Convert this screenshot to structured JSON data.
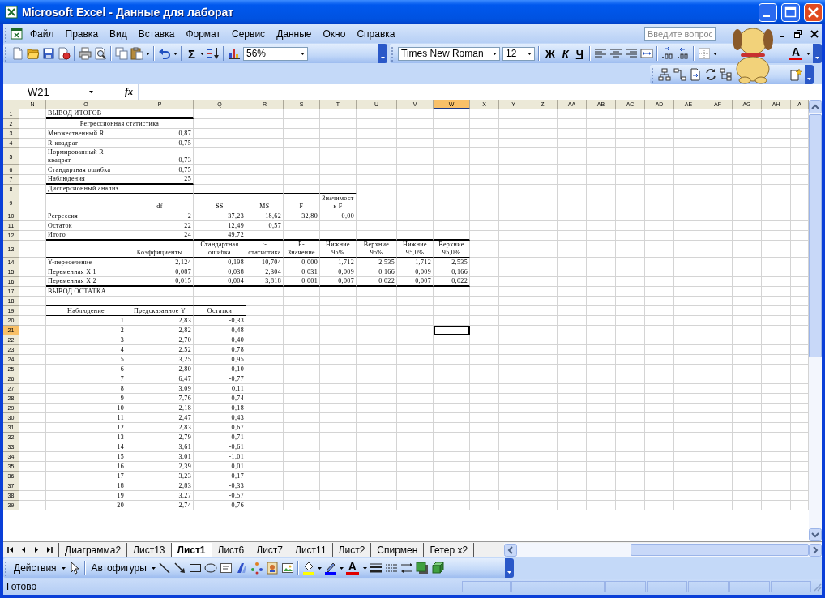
{
  "window": {
    "title": "Microsoft Excel - Данные для лаборат"
  },
  "menu": [
    "Файл",
    "Правка",
    "Вид",
    "Вставка",
    "Формат",
    "Сервис",
    "Данные",
    "Окно",
    "Справка"
  ],
  "help_search": {
    "placeholder": "Введите вопрос"
  },
  "standard_toolbar": {
    "autosum": "Σ",
    "zoom": "56%"
  },
  "formatting_toolbar": {
    "font": "Times New Roman",
    "size": "12",
    "bold": "Ж",
    "italic": "К",
    "underline": "Ч",
    "font_color": "A"
  },
  "formula_bar": {
    "name_box": "W21",
    "fx": "fx"
  },
  "columns": [
    {
      "label": "N",
      "selected": false
    },
    {
      "label": "O",
      "selected": false
    },
    {
      "label": "P",
      "selected": false
    },
    {
      "label": "Q",
      "selected": false
    },
    {
      "label": "R",
      "selected": false
    },
    {
      "label": "S",
      "selected": false
    },
    {
      "label": "T",
      "selected": false
    },
    {
      "label": "U",
      "selected": false
    },
    {
      "label": "V",
      "selected": false
    },
    {
      "label": "W",
      "selected": true
    },
    {
      "label": "X",
      "selected": false
    },
    {
      "label": "Y",
      "selected": false
    },
    {
      "label": "Z",
      "selected": false
    },
    {
      "label": "AA",
      "selected": false
    },
    {
      "label": "AB",
      "selected": false
    },
    {
      "label": "AC",
      "selected": false
    },
    {
      "label": "AD",
      "selected": false
    },
    {
      "label": "AE",
      "selected": false
    },
    {
      "label": "AF",
      "selected": false
    },
    {
      "label": "AG",
      "selected": false
    },
    {
      "label": "AH",
      "selected": false
    },
    {
      "label": "A",
      "selected": false
    }
  ],
  "rows": [
    {
      "label": "1",
      "selected": false,
      "cells": [
        {},
        {
          "text": "ВЫВОД ИТОГОВ",
          "kind": "label",
          "thick_rule": true
        },
        {
          "thick_rule": true
        }
      ]
    },
    {
      "label": "2",
      "selected": false,
      "cells": [
        {},
        {
          "text": "Регрессионная статистика",
          "kind": "title"
        }
      ]
    },
    {
      "label": "3",
      "selected": false,
      "cells": [
        {},
        {
          "text": "Множественный R",
          "kind": "label"
        },
        {
          "text": "0,87",
          "kind": "number"
        }
      ]
    },
    {
      "label": "4",
      "selected": false,
      "cells": [
        {},
        {
          "text": "R-квадрат",
          "kind": "label"
        },
        {
          "text": "0,75",
          "kind": "number"
        }
      ]
    },
    {
      "label": "5",
      "selected": false,
      "cells": [
        {},
        {
          "text": "Нормированный R-квадрат",
          "kind": "label",
          "wrap": true
        },
        {
          "text": "0,73",
          "kind": "number"
        }
      ]
    },
    {
      "label": "6",
      "selected": false,
      "cells": [
        {},
        {
          "text": "Стандартная ошибка",
          "kind": "label"
        },
        {
          "text": "0,75",
          "kind": "number"
        }
      ]
    },
    {
      "label": "7",
      "selected": false,
      "cells": [
        {},
        {
          "text": "Наблюдения",
          "kind": "label",
          "thick_rule": true
        },
        {
          "text": "25",
          "kind": "number",
          "thick_rule": true
        }
      ]
    },
    {
      "label": "8",
      "selected": false,
      "cells": [
        {},
        {
          "text": "Дисперсионный анализ",
          "kind": "label",
          "thick_rule": true
        },
        {
          "thick_rule": true
        },
        {
          "thick_rule": true
        },
        {
          "thick_rule": true
        },
        {
          "thick_rule": true
        },
        {
          "thick_rule": true
        }
      ]
    },
    {
      "label": "9",
      "selected": false,
      "cells": [
        {},
        {
          "thin_rule": true
        },
        {
          "text": "df",
          "kind": "header",
          "thin_rule": true
        },
        {
          "text": "SS",
          "kind": "header",
          "thin_rule": true
        },
        {
          "text": "MS",
          "kind": "header",
          "thin_rule": true
        },
        {
          "text": "F",
          "kind": "header",
          "thin_rule": true
        },
        {
          "text": "Значимость F",
          "kind": "header",
          "wrap": true,
          "thin_rule": true
        }
      ]
    },
    {
      "label": "10",
      "selected": false,
      "cells": [
        {},
        {
          "text": "Регрессия",
          "kind": "label"
        },
        {
          "text": "2",
          "kind": "number"
        },
        {
          "text": "37,23",
          "kind": "number"
        },
        {
          "text": "18,62",
          "kind": "number"
        },
        {
          "text": "32,80",
          "kind": "number"
        },
        {
          "text": "0,00",
          "kind": "number"
        }
      ]
    },
    {
      "label": "11",
      "selected": false,
      "cells": [
        {},
        {
          "text": "Остаток",
          "kind": "label"
        },
        {
          "text": "22",
          "kind": "number"
        },
        {
          "text": "12,49",
          "kind": "number"
        },
        {
          "text": "0,57",
          "kind": "number"
        }
      ]
    },
    {
      "label": "12",
      "selected": false,
      "cells": [
        {},
        {
          "text": "Итого",
          "kind": "label",
          "thick_rule": true
        },
        {
          "text": "24",
          "kind": "number",
          "thick_rule": true
        },
        {
          "text": "49,72",
          "kind": "number",
          "thick_rule": true
        },
        {
          "thick_rule": true
        },
        {
          "thick_rule": true
        },
        {
          "thick_rule": true
        },
        {
          "thick_rule": true
        },
        {
          "thick_rule": true
        },
        {
          "thick_rule": true
        }
      ]
    },
    {
      "label": "13",
      "selected": false,
      "cells": [
        {},
        {
          "thin_rule": true
        },
        {
          "text": "Коэффициенты",
          "kind": "header",
          "wrap": true,
          "thin_rule": true
        },
        {
          "text": "Стандартная ошибка",
          "kind": "header",
          "wrap": true,
          "thin_rule": true
        },
        {
          "text": "t-статистика",
          "kind": "header",
          "wrap": true,
          "thin_rule": true
        },
        {
          "text": "P-Значение",
          "kind": "header",
          "wrap": true,
          "thin_rule": true
        },
        {
          "text": "Нижние 95%",
          "kind": "header",
          "wrap": true,
          "thin_rule": true
        },
        {
          "text": "Верхние 95%",
          "kind": "header",
          "wrap": true,
          "thin_rule": true
        },
        {
          "text": "Нижние 95,0%",
          "kind": "header",
          "wrap": true,
          "thin_rule": true
        },
        {
          "text": "Верхние 95,0%",
          "kind": "header",
          "wrap": true,
          "thin_rule": true
        }
      ]
    },
    {
      "label": "14",
      "selected": false,
      "cells": [
        {},
        {
          "text": "Y-пересечение",
          "kind": "label"
        },
        {
          "text": "2,124",
          "kind": "number"
        },
        {
          "text": "0,198",
          "kind": "number"
        },
        {
          "text": "10,704",
          "kind": "number"
        },
        {
          "text": "0,000",
          "kind": "number"
        },
        {
          "text": "1,712",
          "kind": "number"
        },
        {
          "text": "2,535",
          "kind": "number"
        },
        {
          "text": "1,712",
          "kind": "number"
        },
        {
          "text": "2,535",
          "kind": "number"
        }
      ]
    },
    {
      "label": "15",
      "selected": false,
      "cells": [
        {},
        {
          "text": "Переменная X 1",
          "kind": "label"
        },
        {
          "text": "0,087",
          "kind": "number"
        },
        {
          "text": "0,038",
          "kind": "number"
        },
        {
          "text": "2,304",
          "kind": "number"
        },
        {
          "text": "0,031",
          "kind": "number"
        },
        {
          "text": "0,009",
          "kind": "number"
        },
        {
          "text": "0,166",
          "kind": "number"
        },
        {
          "text": "0,009",
          "kind": "number"
        },
        {
          "text": "0,166",
          "kind": "number"
        }
      ]
    },
    {
      "label": "16",
      "selected": false,
      "cells": [
        {},
        {
          "text": "Переменная X 2",
          "kind": "label",
          "thick_rule": true
        },
        {
          "text": "0,015",
          "kind": "number",
          "thick_rule": true
        },
        {
          "text": "0,004",
          "kind": "number",
          "thick_rule": true
        },
        {
          "text": "3,818",
          "kind": "number",
          "thick_rule": true
        },
        {
          "text": "0,001",
          "kind": "number",
          "thick_rule": true
        },
        {
          "text": "0,007",
          "kind": "number",
          "thick_rule": true
        },
        {
          "text": "0,022",
          "kind": "number",
          "thick_rule": true
        },
        {
          "text": "0,007",
          "kind": "number",
          "thick_rule": true
        },
        {
          "text": "0,022",
          "kind": "number",
          "thick_rule": true
        }
      ]
    },
    {
      "label": "17",
      "selected": false,
      "cells": [
        {},
        {
          "text": "ВЫВОД ОСТАТКА",
          "kind": "label"
        }
      ]
    },
    {
      "label": "18",
      "selected": false,
      "cells": [
        {},
        {
          "thick_rule": true
        },
        {
          "thick_rule": true
        },
        {
          "thick_rule": true
        }
      ]
    },
    {
      "label": "19",
      "selected": false,
      "cells": [
        {},
        {
          "text": "Наблюдение",
          "kind": "header",
          "thin_rule": true
        },
        {
          "text": "Предсказанное Y",
          "kind": "header",
          "thin_rule": true
        },
        {
          "text": "Остатки",
          "kind": "header",
          "thin_rule": true
        }
      ]
    },
    {
      "label": "20",
      "selected": false,
      "cells": [
        {},
        {
          "text": "1",
          "kind": "number"
        },
        {
          "text": "2,83",
          "kind": "number"
        },
        {
          "text": "-0,33",
          "kind": "number"
        }
      ]
    },
    {
      "label": "21",
      "selected": true,
      "cells": [
        {},
        {
          "text": "2",
          "kind": "number"
        },
        {
          "text": "2,82",
          "kind": "number"
        },
        {
          "text": "0,48",
          "kind": "number"
        }
      ]
    },
    {
      "label": "22",
      "selected": false,
      "cells": [
        {},
        {
          "text": "3",
          "kind": "number"
        },
        {
          "text": "2,70",
          "kind": "number"
        },
        {
          "text": "-0,40",
          "kind": "number"
        }
      ]
    },
    {
      "label": "23",
      "selected": false,
      "cells": [
        {},
        {
          "text": "4",
          "kind": "number"
        },
        {
          "text": "2,52",
          "kind": "number"
        },
        {
          "text": "0,78",
          "kind": "number"
        }
      ]
    },
    {
      "label": "24",
      "selected": false,
      "cells": [
        {},
        {
          "text": "5",
          "kind": "number"
        },
        {
          "text": "3,25",
          "kind": "number"
        },
        {
          "text": "0,95",
          "kind": "number"
        }
      ]
    },
    {
      "label": "25",
      "selected": false,
      "cells": [
        {},
        {
          "text": "6",
          "kind": "number"
        },
        {
          "text": "2,80",
          "kind": "number"
        },
        {
          "text": "0,10",
          "kind": "number"
        }
      ]
    },
    {
      "label": "26",
      "selected": false,
      "cells": [
        {},
        {
          "text": "7",
          "kind": "number"
        },
        {
          "text": "6,47",
          "kind": "number"
        },
        {
          "text": "-0,77",
          "kind": "number"
        }
      ]
    },
    {
      "label": "27",
      "selected": false,
      "cells": [
        {},
        {
          "text": "8",
          "kind": "number"
        },
        {
          "text": "3,09",
          "kind": "number"
        },
        {
          "text": "0,11",
          "kind": "number"
        }
      ]
    },
    {
      "label": "28",
      "selected": false,
      "cells": [
        {},
        {
          "text": "9",
          "kind": "number"
        },
        {
          "text": "7,76",
          "kind": "number"
        },
        {
          "text": "0,74",
          "kind": "number"
        }
      ]
    },
    {
      "label": "29",
      "selected": false,
      "cells": [
        {},
        {
          "text": "10",
          "kind": "number"
        },
        {
          "text": "2,18",
          "kind": "number"
        },
        {
          "text": "-0,18",
          "kind": "number"
        }
      ]
    },
    {
      "label": "30",
      "selected": false,
      "cells": [
        {},
        {
          "text": "11",
          "kind": "number"
        },
        {
          "text": "2,47",
          "kind": "number"
        },
        {
          "text": "0,43",
          "kind": "number"
        }
      ]
    },
    {
      "label": "31",
      "selected": false,
      "cells": [
        {},
        {
          "text": "12",
          "kind": "number"
        },
        {
          "text": "2,83",
          "kind": "number"
        },
        {
          "text": "0,67",
          "kind": "number"
        }
      ]
    },
    {
      "label": "32",
      "selected": false,
      "cells": [
        {},
        {
          "text": "13",
          "kind": "number"
        },
        {
          "text": "2,79",
          "kind": "number"
        },
        {
          "text": "0,71",
          "kind": "number"
        }
      ]
    },
    {
      "label": "33",
      "selected": false,
      "cells": [
        {},
        {
          "text": "14",
          "kind": "number"
        },
        {
          "text": "3,61",
          "kind": "number"
        },
        {
          "text": "-0,61",
          "kind": "number"
        }
      ]
    },
    {
      "label": "34",
      "selected": false,
      "cells": [
        {},
        {
          "text": "15",
          "kind": "number"
        },
        {
          "text": "3,01",
          "kind": "number"
        },
        {
          "text": "-1,01",
          "kind": "number"
        }
      ]
    },
    {
      "label": "35",
      "selected": false,
      "cells": [
        {},
        {
          "text": "16",
          "kind": "number"
        },
        {
          "text": "2,39",
          "kind": "number"
        },
        {
          "text": "0,01",
          "kind": "number"
        }
      ]
    },
    {
      "label": "36",
      "selected": false,
      "cells": [
        {},
        {
          "text": "17",
          "kind": "number"
        },
        {
          "text": "3,23",
          "kind": "number"
        },
        {
          "text": "0,17",
          "kind": "number"
        }
      ]
    },
    {
      "label": "37",
      "selected": false,
      "cells": [
        {},
        {
          "text": "18",
          "kind": "number"
        },
        {
          "text": "2,83",
          "kind": "number"
        },
        {
          "text": "-0,33",
          "kind": "number"
        }
      ]
    },
    {
      "label": "38",
      "selected": false,
      "cells": [
        {},
        {
          "text": "19",
          "kind": "number"
        },
        {
          "text": "3,27",
          "kind": "number"
        },
        {
          "text": "-0,57",
          "kind": "number"
        }
      ]
    },
    {
      "label": "39",
      "selected": false,
      "cells": [
        {},
        {
          "text": "20",
          "kind": "number"
        },
        {
          "text": "2,74",
          "kind": "number"
        },
        {
          "text": "0,76",
          "kind": "number"
        }
      ]
    }
  ],
  "sheet_tabs": [
    {
      "label": "Диаграмма2",
      "selected": false
    },
    {
      "label": "Лист13",
      "selected": false
    },
    {
      "label": "Лист1",
      "selected": true
    },
    {
      "label": "Лист6",
      "selected": false
    },
    {
      "label": "Лист7",
      "selected": false
    },
    {
      "label": "Лист11",
      "selected": false
    },
    {
      "label": "Лист2",
      "selected": false
    },
    {
      "label": "Спирмен",
      "selected": false
    },
    {
      "label": "Гетер x2",
      "selected": false
    }
  ],
  "drawing_toolbar": {
    "actions": "Действия",
    "autoshapes": "Автофигуры",
    "font_color": "A"
  },
  "status_bar": {
    "text": "Готово"
  }
}
